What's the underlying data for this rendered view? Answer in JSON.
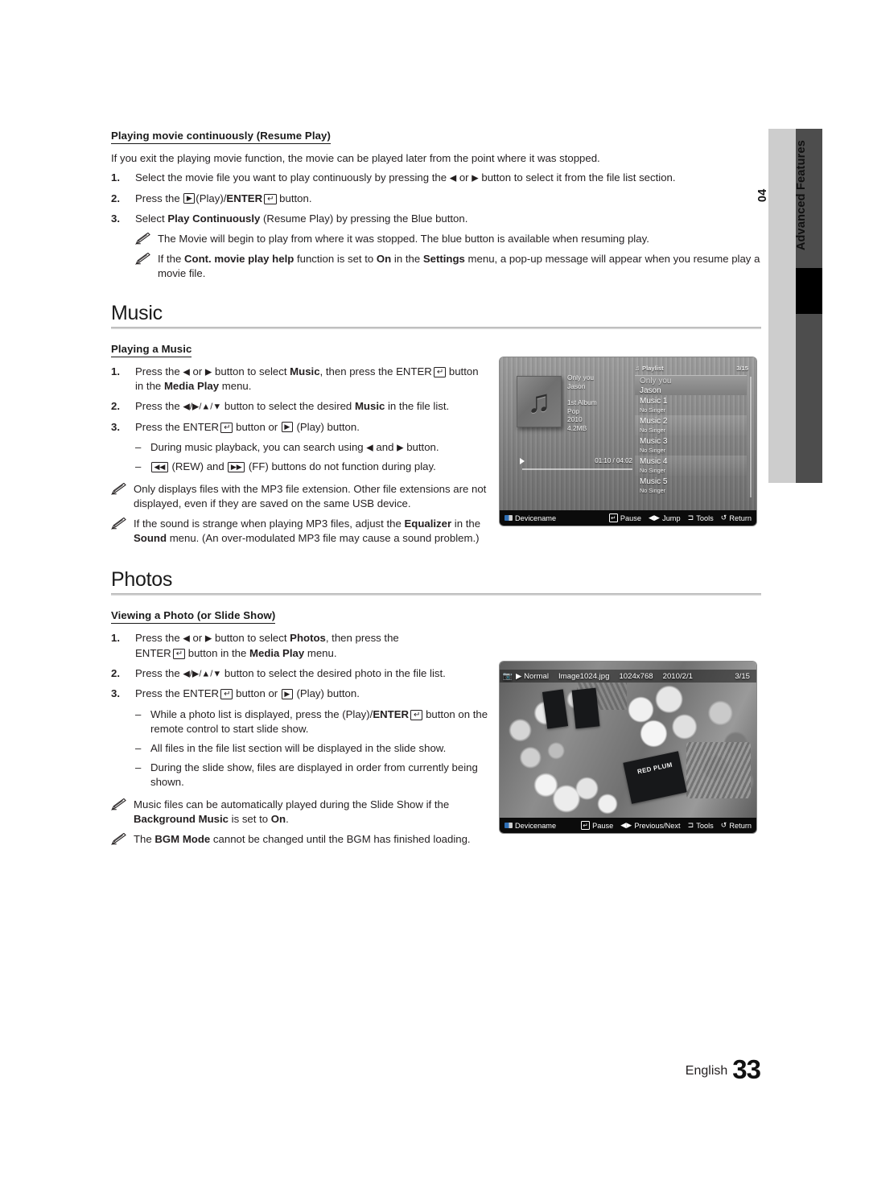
{
  "side_tab": {
    "number": "04",
    "label": "Advanced Features"
  },
  "resume": {
    "heading": "Playing movie continuously (Resume Play)",
    "intro": "If you exit the playing movie function, the movie can be played later from the point where it was stopped.",
    "steps": [
      {
        "num": "1.",
        "pre": "Select the movie file you want to play continuously by pressing the ",
        "arrow_left": "◀",
        "mid": " or ",
        "arrow_right": "▶",
        "post": " button to select it from the file list section."
      },
      {
        "num": "2.",
        "pre": "Press the ",
        "play_key": "▶",
        "mid": "(Play)/",
        "bold": "ENTER",
        "enter_key": "↵",
        "post": " button."
      },
      {
        "num": "3.",
        "pre": "Select ",
        "bold": "Play Continuously",
        "post": " (Resume Play) by pressing the Blue button."
      }
    ],
    "notes": [
      "The Movie will begin to play from where it was stopped. The blue button is available when resuming play.",
      "If the Cont. movie play help function is set to On in the Settings menu, a pop-up message will appear when you resume play a movie file."
    ],
    "note2_parts": {
      "a": "If the ",
      "b1": "Cont. movie play help",
      "c": " function is set to ",
      "b2": "On",
      "d": " in the ",
      "b3": "Settings",
      "e": " menu, a pop-up message will appear when you resume play a movie file."
    }
  },
  "music": {
    "title": "Music",
    "sub_heading": "Playing a Music",
    "steps": [
      {
        "num": "1.",
        "a": "Press the ",
        "arr1": "◀",
        "b": " or ",
        "arr2": "▶",
        "c": " button to select ",
        "bold1": "Music",
        "d": ", then press the ",
        "enter_word": "ENTER",
        "e": " button in the ",
        "bold2": "Media Play",
        "f": " menu."
      },
      {
        "num": "2.",
        "a": "Press the ",
        "arrows": "◀/▶/▲/▼",
        "b": " button to select the desired ",
        "bold1": "Music",
        "c": " in the file list."
      },
      {
        "num": "3.",
        "a": "Press the ",
        "enter_word": "ENTER",
        "b": " button or ",
        "play": "▶",
        "c": " (Play) button."
      }
    ],
    "dashes": [
      {
        "a": "During music playback, you can search using ",
        "arr1": "◀",
        "b": " and ",
        "arr2": "▶",
        "c": " button."
      },
      {
        "rew": "◀◀",
        "a": " (REW) and ",
        "ff": "▶▶",
        "b": " (FF) buttons do not function during play."
      }
    ],
    "notes": [
      "Only displays files with the MP3 file extension. Other file extensions are not displayed, even if they are saved on the same USB device.",
      "If the sound is strange when playing MP3 files, adjust the Equalizer in the Sound menu. (An over-modulated MP3 file may cause a sound problem.)"
    ],
    "note2_parts": {
      "a": "If the sound is strange when playing MP3 files, adjust the ",
      "b1": "Equalizer",
      "c": " in the ",
      "b2": "Sound",
      "d": " menu. (An over-modulated MP3 file may cause a sound problem.)"
    }
  },
  "music_screen": {
    "album_icon": "music-note-icon",
    "track_title": "Only you",
    "track_artist": "Jason",
    "album": "1st Album",
    "genre": "Pop",
    "year": "2010",
    "size": "4.2MB",
    "elapsed_total": "01:10 / 04:02",
    "playlist_label": "Playlist",
    "playlist_count": "3/15",
    "items": [
      {
        "title": "Only you",
        "sub": "Jason",
        "selected": true
      },
      {
        "title": "Music 1",
        "sub": "No Singer",
        "selected": false
      },
      {
        "title": "Music 2",
        "sub": "No Singer",
        "selected": false
      },
      {
        "title": "Music 3",
        "sub": "No Singer",
        "selected": false
      },
      {
        "title": "Music 4",
        "sub": "No Singer",
        "selected": false
      },
      {
        "title": "Music 5",
        "sub": "No Singer",
        "selected": false
      }
    ],
    "bottom": {
      "device": "Devicename",
      "pause": "Pause",
      "jump": "Jump",
      "tools": "Tools",
      "return": "Return",
      "enter_glyph": "↵",
      "jump_glyph": "◀▶",
      "tools_glyph": "⊐",
      "return_glyph": "↺"
    }
  },
  "photos": {
    "title": "Photos",
    "sub_heading": "Viewing a Photo (or Slide Show)",
    "steps": [
      {
        "num": "1.",
        "a": "Press the ",
        "arr1": "◀",
        "b": " or ",
        "arr2": "▶",
        "c": " button to select ",
        "bold1": "Photos",
        "d": ", then press the ",
        "enter_word": "ENTER",
        "e": " button in the ",
        "bold2": "Media Play",
        "f": " menu."
      },
      {
        "num": "2.",
        "a": "Press the ",
        "arrows": "◀/▶/▲/▼",
        "b": " button to select the desired photo in the file list."
      },
      {
        "num": "3.",
        "a": "Press the ",
        "enter_word": "ENTER",
        "b": " button or ",
        "play": "▶",
        "c": " (Play) button."
      }
    ],
    "dashes": [
      {
        "a": "While a photo list is displayed, press the (Play)/",
        "bold": "ENTER",
        "b": " button on the remote control to start slide show."
      },
      {
        "a": "All files in the file list section will be displayed in the slide show."
      },
      {
        "a": "During the slide show, files are displayed in order from currently being shown."
      }
    ],
    "notes": [
      "Music files can be automatically played during the Slide Show if the Background Music is set to On.",
      "The BGM Mode cannot be changed until the BGM has finished loading."
    ],
    "note1_parts": {
      "a": "Music files can be automatically played during the Slide Show if the ",
      "b1": "Background Music",
      "c": " is set to ",
      "b2": "On",
      "d": "."
    },
    "note2_parts": {
      "a": "The ",
      "b1": "BGM Mode",
      "c": " cannot be changed until the BGM has finished loading."
    }
  },
  "photo_screen": {
    "mode_icon": "photo-mode-icon",
    "play_glyph": "▶",
    "mode": "Normal",
    "filename": "Image1024.jpg",
    "resolution": "1024x768",
    "date": "2010/2/1",
    "count": "3/15",
    "sign_text": "RED PLUM",
    "bottom": {
      "device": "Devicename",
      "pause": "Pause",
      "previous_next": "Previous/Next",
      "tools": "Tools",
      "return": "Return",
      "enter_glyph": "↵",
      "prevnext_glyph": "◀▶",
      "tools_glyph": "⊐",
      "return_glyph": "↺"
    }
  },
  "footer": {
    "language": "English",
    "page": "33"
  },
  "colors": {
    "text": "#231f20",
    "tab_light": "#cdcdcd",
    "tab_dark": "#4d4d4d",
    "tab_black": "#000000",
    "rule": "#b8b8b8"
  }
}
